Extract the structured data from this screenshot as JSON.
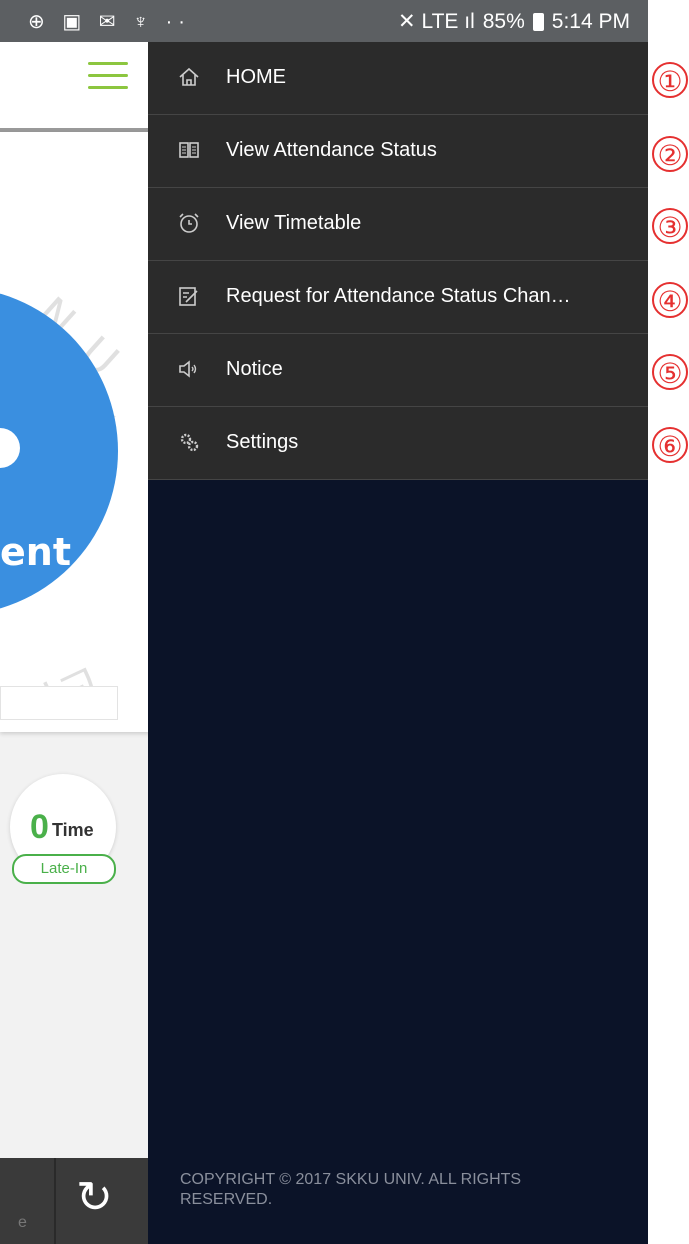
{
  "status_bar": {
    "left_icons": "⊕ ▣ ✉ ♆ ··",
    "network": "✕ LTE ıl",
    "battery_text": "85%",
    "time": "5:14 PM"
  },
  "background": {
    "big_word": "ent",
    "watermark_text": "N U N I V",
    "watermark_text2": "학교",
    "stat_number": "0",
    "stat_unit": "Time",
    "stat_badge": "Late-In"
  },
  "drawer": {
    "items": [
      {
        "label": "HOME",
        "icon": "home-icon"
      },
      {
        "label": "View Attendance Status",
        "icon": "book-icon"
      },
      {
        "label": "View Timetable",
        "icon": "alarm-clock-icon"
      },
      {
        "label": "Request for Attendance Status Chan…",
        "icon": "edit-note-icon"
      },
      {
        "label": "Notice",
        "icon": "speaker-icon"
      },
      {
        "label": "Settings",
        "icon": "gears-icon"
      }
    ],
    "copyright": "COPYRIGHT © 2017 SKKU UNIV. ALL RIGHTS RESERVED."
  },
  "callouts": [
    "①",
    "②",
    "③",
    "④",
    "⑤",
    "⑥"
  ],
  "colors": {
    "drawer_bg": "#0b1328",
    "menu_item_bg": "#2b2b2b",
    "accent_green": "#4ab04a",
    "callout_red": "#e53030"
  }
}
